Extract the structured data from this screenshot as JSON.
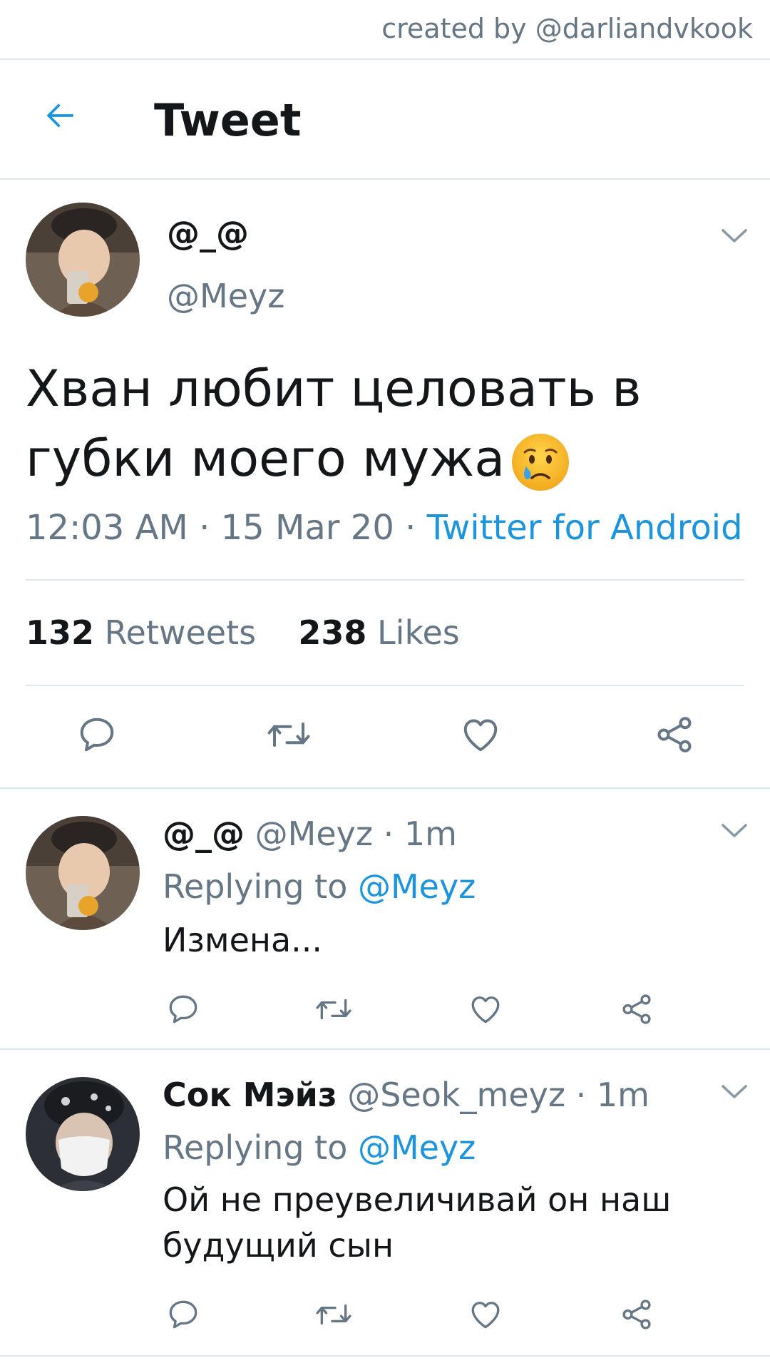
{
  "watermark": "created by @darliandvkook",
  "header": {
    "title": "Tweet"
  },
  "tweet": {
    "name": "@_@",
    "handle": "@Meyz",
    "text": "Хван любит целовать в губки моего мужа",
    "emoji": "crying-face-emoji",
    "time": "12:03 AM",
    "date": "15 Mar 20",
    "source": "Twitter for Android",
    "retweets": "132",
    "retweets_label": "Retweets",
    "likes": "238",
    "likes_label": "Likes"
  },
  "replies": [
    {
      "name": "@_@",
      "handle": "@Meyz",
      "age": "1m",
      "replying_label": "Replying to",
      "replying_handle": "@Meyz",
      "text": "Измена..."
    },
    {
      "name": "Сок Мэйз",
      "handle": "@Seok_meyz",
      "age": "1m",
      "replying_label": "Replying to",
      "replying_handle": "@Meyz",
      "text": "Ой не преувеличивай он наш будущий сын"
    }
  ],
  "colors": {
    "link": "#1b95e0",
    "muted": "#657786",
    "divider": "#e1e8ed"
  }
}
